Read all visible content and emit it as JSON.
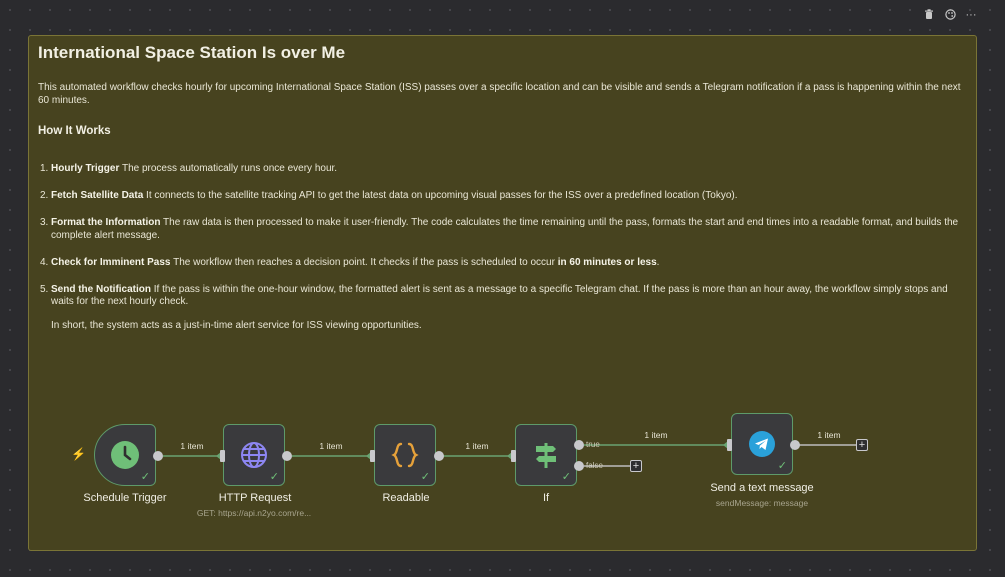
{
  "toolbar": {
    "delete_icon": "trash-icon",
    "color_icon": "palette-icon",
    "more_icon": "ellipsis-icon",
    "more_label": "···"
  },
  "note": {
    "title": "International Space Station Is over Me",
    "intro": "This automated workflow checks hourly for upcoming International Space Station (ISS) passes over a specific location and can be visible and sends a Telegram notification if a pass is happening within the next 60 minutes.",
    "how_title": "How It Works",
    "steps": [
      {
        "num": "1.",
        "bold": "Hourly Trigger",
        "text": " The process automatically runs once every hour."
      },
      {
        "num": "2.",
        "bold": "Fetch Satellite Data",
        "text": " It connects to the satellite tracking API to get the latest data on upcoming visual passes for the ISS over a predefined location (Tokyo)."
      },
      {
        "num": "3.",
        "bold": "Format the Information",
        "text": " The raw data is then processed to make it user-friendly. The code calculates the time remaining until the pass, formats the start and end times into a readable format, and builds the complete alert message."
      },
      {
        "num": "4.",
        "bold": "Check for Imminent Pass",
        "text": " The workflow then reaches a decision point. It checks if the pass is scheduled to occur ",
        "bold2": "in 60 minutes or less",
        "text2": "."
      },
      {
        "num": "5.",
        "bold": "Send the Notification",
        "text": " If the pass is within the one-hour window, the formatted alert is sent as a message to a specific Telegram chat. If the pass is more than an hour away, the workflow simply stops and waits for the next hourly check."
      }
    ],
    "summary": "In short, the system acts as a just-in-time alert service for ISS viewing opportunities."
  },
  "workflow": {
    "nodes": [
      {
        "name": "Schedule Trigger",
        "subtitle": "",
        "icon": "clock-icon"
      },
      {
        "name": "HTTP Request",
        "subtitle": "GET: https://api.n2yo.com/re...",
        "icon": "globe-icon"
      },
      {
        "name": "Readable",
        "subtitle": "",
        "icon": "code-braces-icon"
      },
      {
        "name": "If",
        "subtitle": "",
        "icon": "signpost-icon"
      },
      {
        "name": "Send a text message",
        "subtitle": "sendMessage: message",
        "icon": "telegram-icon"
      }
    ],
    "edges": [
      "1 item",
      "1 item",
      "1 item",
      "1 item",
      "1 item"
    ],
    "branch_true": "true",
    "branch_false": "false",
    "add_label": "+",
    "check_mark": "✓",
    "trigger_icon": "bolt-icon",
    "bolt_glyph": "⚡",
    "colors": {
      "success": "#6fbf78",
      "code": "#e6a13a",
      "telegram": "#2aa1da",
      "note_bg": "#47431f"
    }
  }
}
